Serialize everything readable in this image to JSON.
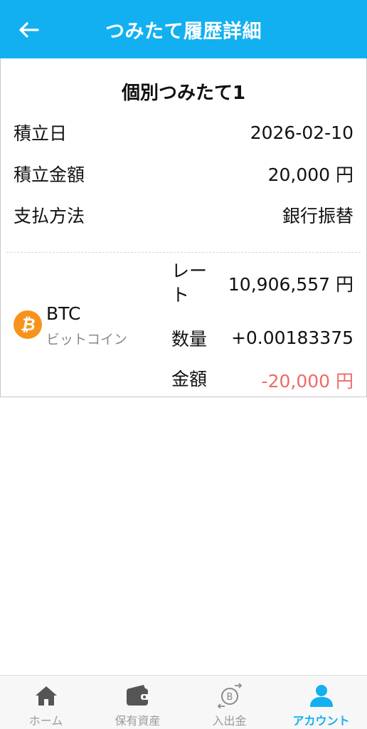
{
  "header": {
    "title": "つみたて履歴詳細",
    "back_icon": "arrow-left-icon"
  },
  "card": {
    "title": "個別つみたて1",
    "rows": [
      {
        "label": "積立日",
        "value": "2026-02-10"
      },
      {
        "label": "積立金額",
        "value": "20,000 円"
      },
      {
        "label": "支払方法",
        "value": "銀行振替"
      }
    ],
    "coin": {
      "icon": "bitcoin-icon",
      "icon_color": "#f7931a",
      "symbol": "BTC",
      "name": "ビットコイン"
    },
    "details": {
      "rate_label": "レート",
      "rate_value": "10,906,557 円",
      "quantity_label": "数量",
      "quantity_value": "+0.00183375",
      "amount_label": "金額",
      "amount_value": "-20,000 円",
      "amount_color": "#ef6a6a"
    }
  },
  "bottom_nav": {
    "items": [
      {
        "label": "ホーム",
        "icon": "home-icon",
        "active": false
      },
      {
        "label": "保有資産",
        "icon": "wallet-icon",
        "active": false
      },
      {
        "label": "入出金",
        "icon": "bitcoin-transfer-icon",
        "active": false
      },
      {
        "label": "アカウント",
        "icon": "person-icon",
        "active": true
      }
    ],
    "active_color": "#12b0f0"
  },
  "colors": {
    "header_bg": "#12b0f0",
    "negative": "#ef6a6a"
  }
}
